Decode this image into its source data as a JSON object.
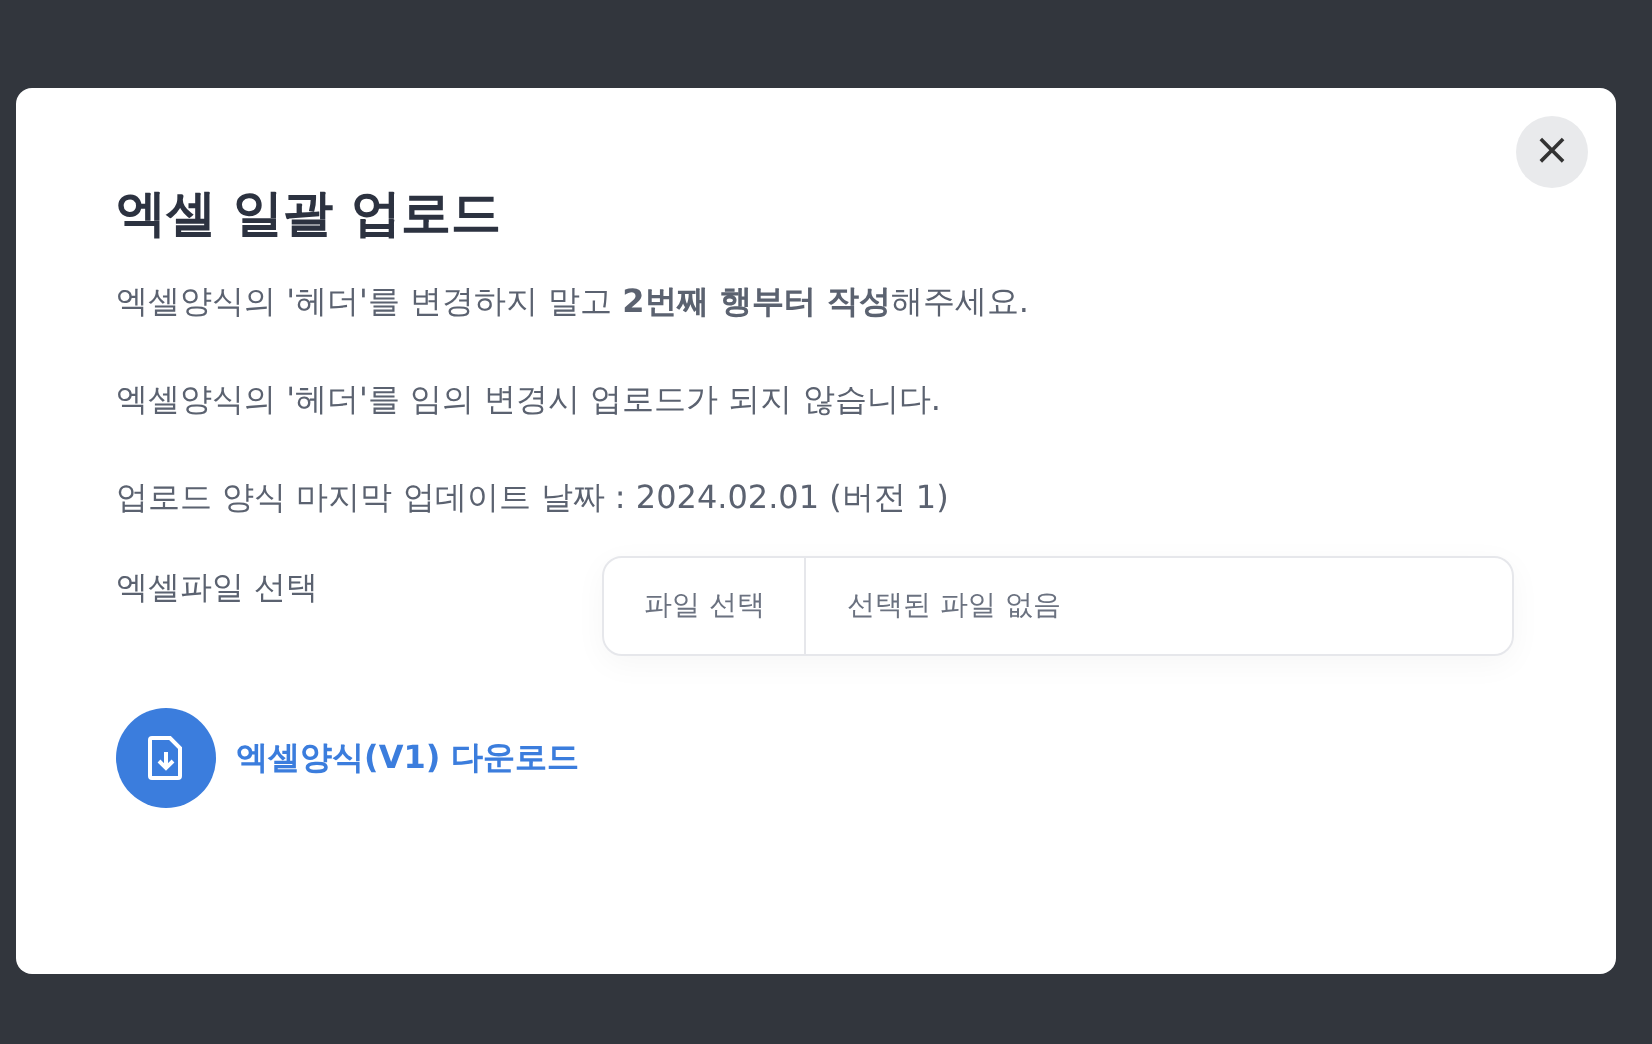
{
  "modal": {
    "title": "엑셀 일괄 업로드",
    "close": "×",
    "notes": [
      "엑셀양식의 '헤더'를 변경하지 말고 **2번째 행부터 작성**해주세요.",
      "엑셀양식의 '헤더'를 임의 변경시 업로드가 되지 않습니다.",
      "업로드 양식 마지막 업데이트 날짜 : 2024.02.01 (버전 1)"
    ],
    "file_field": {
      "label": "엑셀파일 선택",
      "button": "파일 선택",
      "value": "선택된 파일 없음"
    },
    "download_link": "엑셀양식(V1) 다운로드"
  }
}
